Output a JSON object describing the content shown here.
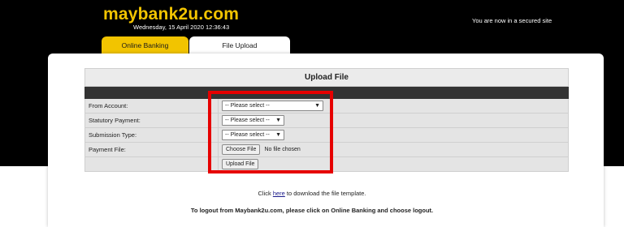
{
  "header": {
    "logo": "maybank2u.com",
    "datetime": "Wednesday, 15 April 2020 12:36:43",
    "secured_text": "You are now in a secured site"
  },
  "tabs": [
    {
      "label": "Online Banking",
      "color": "#f2c400"
    },
    {
      "label": "File Upload",
      "color": "#ffffff"
    }
  ],
  "form": {
    "title": "Upload File",
    "rows": [
      {
        "label": "From Account:",
        "value": "-- Please select --"
      },
      {
        "label": "Statutory Payment:",
        "value": "-- Please select --"
      },
      {
        "label": "Submission Type:",
        "value": "-- Please select --"
      },
      {
        "label": "Payment File:",
        "button": "Choose File",
        "status": "No file chosen"
      }
    ],
    "upload_button": "Upload File"
  },
  "footer": {
    "template_prefix": "Click ",
    "template_link": "here",
    "template_suffix": " to download the file template.",
    "logout_text": "To logout from Maybank2u.com, please click on Online Banking and choose logout."
  },
  "colors": {
    "brand_yellow": "#f2c400",
    "highlight_red": "#e60000"
  }
}
